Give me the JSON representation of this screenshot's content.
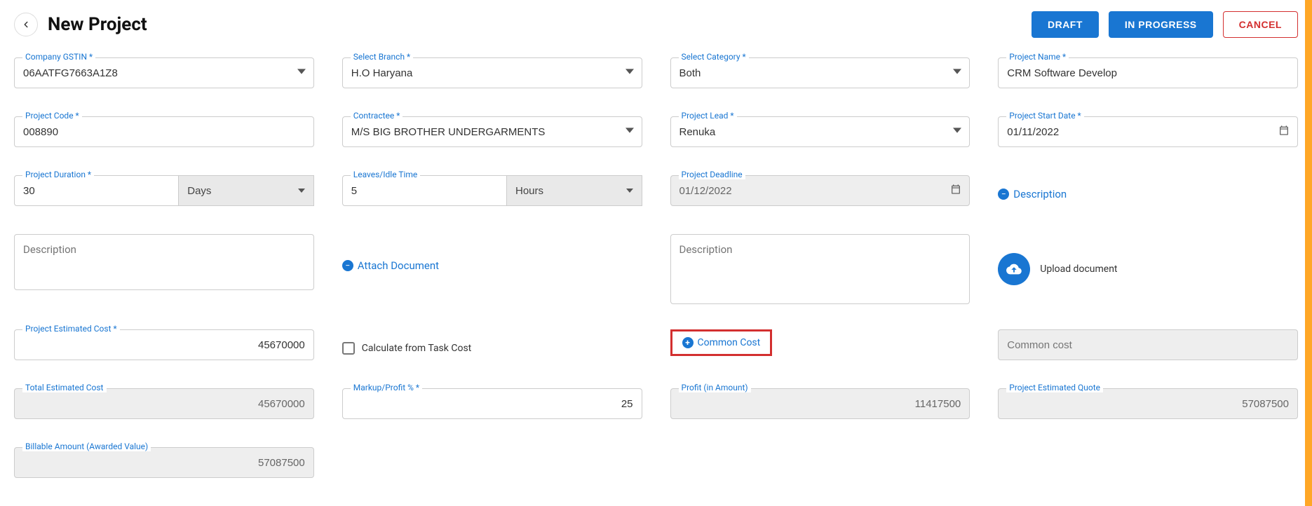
{
  "header": {
    "title": "New Project",
    "draft": "DRAFT",
    "inProgress": "IN PROGRESS",
    "cancel": "CANCEL"
  },
  "fields": {
    "gstin": {
      "label": "Company GSTIN *",
      "value": "06AATFG7663A1Z8"
    },
    "branch": {
      "label": "Select Branch *",
      "value": "H.O Haryana"
    },
    "category": {
      "label": "Select Category *",
      "value": "Both"
    },
    "projectName": {
      "label": "Project Name *",
      "value": "CRM Software Develop"
    },
    "projectCode": {
      "label": "Project Code *",
      "value": "008890"
    },
    "contractee": {
      "label": "Contractee *",
      "value": "M/S BIG BROTHER UNDERGARMENTS"
    },
    "projectLead": {
      "label": "Project Lead *",
      "value": "Renuka"
    },
    "startDate": {
      "label": "Project Start Date *",
      "value": "01/11/2022"
    },
    "duration": {
      "label": "Project Duration *",
      "value": "30",
      "unit": "Days"
    },
    "leaves": {
      "label": "Leaves/Idle Time",
      "value": "5",
      "unit": "Hours"
    },
    "deadline": {
      "label": "Project Deadline",
      "value": "01/12/2022"
    },
    "descToggle": "Description",
    "desc1": {
      "placeholder": "Description"
    },
    "attachDoc": "Attach Document",
    "desc2": {
      "placeholder": "Description"
    },
    "uploadDoc": "Upload document",
    "estCost": {
      "label": "Project Estimated Cost *",
      "value": "45670000"
    },
    "calcTask": "Calculate from Task Cost",
    "commonCostLink": "Common Cost",
    "commonCost": {
      "placeholder": "Common cost"
    },
    "totalEst": {
      "label": "Total Estimated Cost",
      "value": "45670000"
    },
    "markup": {
      "label": "Markup/Profit % *",
      "value": "25"
    },
    "profit": {
      "label": "Profit (in Amount)",
      "value": "11417500"
    },
    "estQuote": {
      "label": "Project Estimated Quote",
      "value": "57087500"
    },
    "billable": {
      "label": "Billable Amount (Awarded Value)",
      "value": "57087500"
    }
  }
}
